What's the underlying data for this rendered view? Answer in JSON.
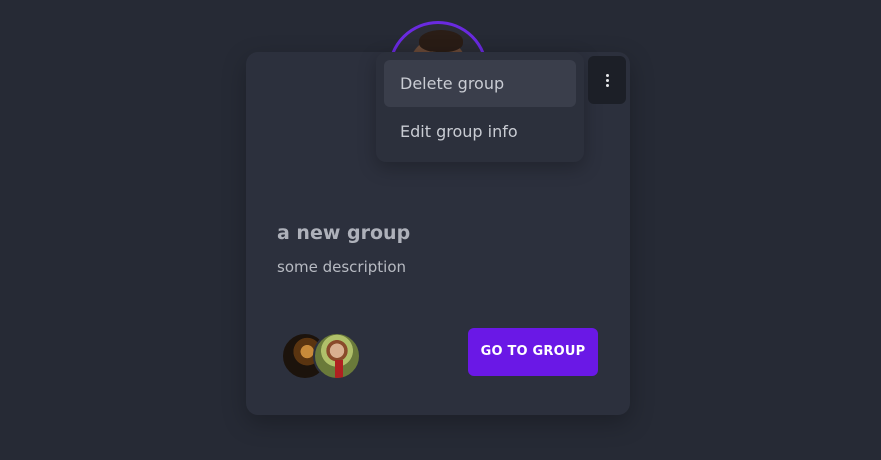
{
  "group": {
    "title": "a new group",
    "description": "some description"
  },
  "menu": {
    "items": [
      {
        "label": "Delete group",
        "highlighted": true
      },
      {
        "label": "Edit group info",
        "highlighted": false
      }
    ]
  },
  "actions": {
    "go_to_group_label": "GO TO GROUP"
  },
  "icons": {
    "menu": "more-vertical-icon"
  },
  "colors": {
    "accent": "#6a18e6",
    "avatar_ring": "#6a2ae0",
    "background": "#262a35",
    "card": "#2c303d"
  }
}
